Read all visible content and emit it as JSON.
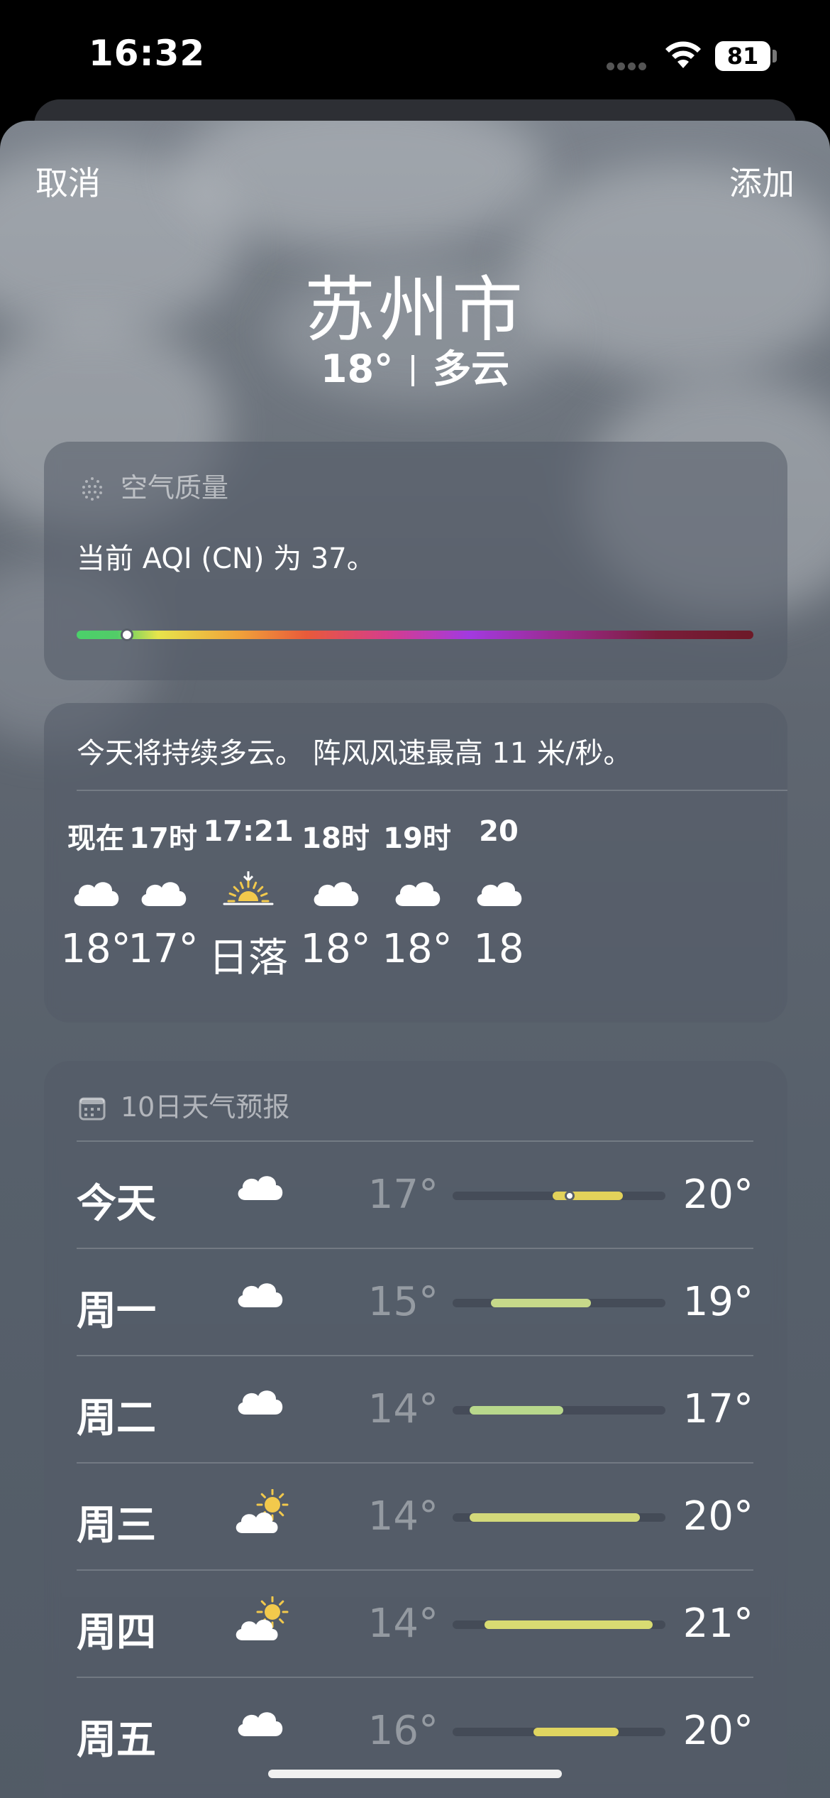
{
  "status_bar": {
    "time": "16:32",
    "battery": "81"
  },
  "nav": {
    "cancel_label": "取消",
    "add_label": "添加"
  },
  "location": {
    "city": "苏州市",
    "current_temp": "18°",
    "condition": "多云"
  },
  "air_quality": {
    "title": "空气质量",
    "text": "当前 AQI (CN) 为 37。",
    "aqi_value": 37,
    "icon": "air-quality-icon"
  },
  "hourly": {
    "summary": "今天将持续多云。 阵风风速最高 11 米/秒。",
    "items": [
      {
        "label": "现在",
        "icon": "cloud-icon",
        "temp": "18°"
      },
      {
        "label": "17时",
        "icon": "cloud-icon",
        "temp": "17°"
      },
      {
        "label": "17:21",
        "icon": "sunset-icon",
        "temp": "日落"
      },
      {
        "label": "18时",
        "icon": "cloud-icon",
        "temp": "18°"
      },
      {
        "label": "19时",
        "icon": "cloud-icon",
        "temp": "18°"
      },
      {
        "label": "20",
        "icon": "cloud-icon",
        "temp": "18"
      }
    ]
  },
  "daily": {
    "title": "10日天气预报",
    "icon": "calendar-icon",
    "days": [
      {
        "name": "今天",
        "icon": "cloud-icon",
        "low": "17°",
        "high": "20°",
        "range_start": 0.47,
        "range_end": 0.8,
        "now": 0.55,
        "color": "#e3d25a"
      },
      {
        "name": "周一",
        "icon": "cloud-icon",
        "low": "15°",
        "high": "19°",
        "range_start": 0.18,
        "range_end": 0.65,
        "color": "#c7d98a"
      },
      {
        "name": "周二",
        "icon": "cloud-icon",
        "low": "14°",
        "high": "17°",
        "range_start": 0.08,
        "range_end": 0.52,
        "color": "#b8d88c"
      },
      {
        "name": "周三",
        "icon": "partly-sunny-icon",
        "low": "14°",
        "high": "20°",
        "range_start": 0.08,
        "range_end": 0.88,
        "color": "#d3d97a"
      },
      {
        "name": "周四",
        "icon": "partly-sunny-icon",
        "low": "14°",
        "high": "21°",
        "range_start": 0.15,
        "range_end": 0.94,
        "color": "#d8db72"
      },
      {
        "name": "周五",
        "icon": "cloud-icon",
        "low": "16°",
        "high": "20°",
        "range_start": 0.38,
        "range_end": 0.78,
        "color": "#e0d560"
      }
    ]
  },
  "colors": {
    "accent_yellow": "#f2c94c",
    "range_track": "#3a414c"
  }
}
